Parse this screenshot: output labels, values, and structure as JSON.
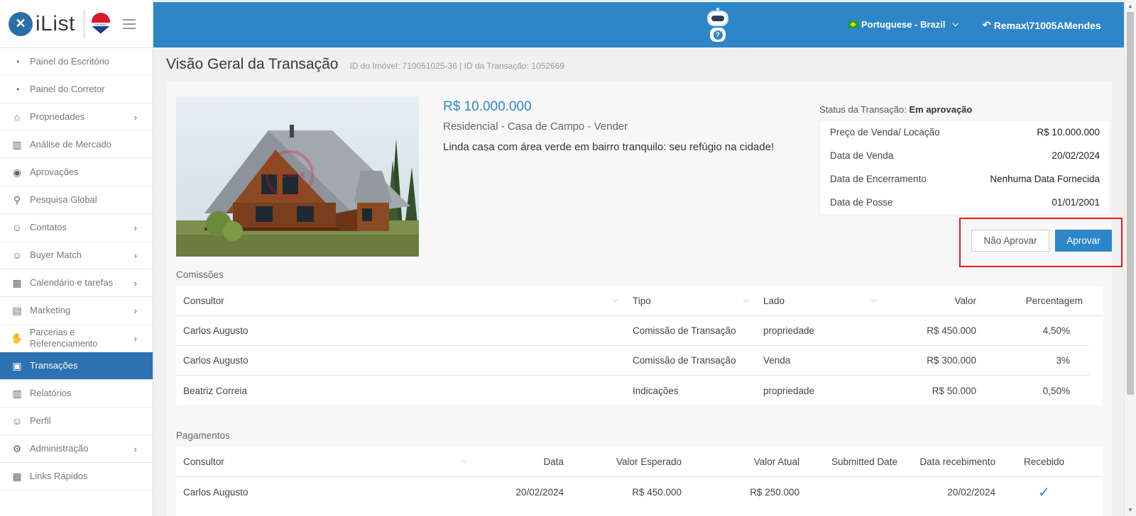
{
  "sidebar": {
    "logo_text": "iList",
    "brand_badge": "RE/MAX",
    "items": [
      {
        "label": "Painel do Escritório",
        "icon": "gauge-icon",
        "glyph": "◔",
        "chevron": false
      },
      {
        "label": "Painel do Corretor",
        "icon": "gauge-icon",
        "glyph": "◔",
        "chevron": false
      },
      {
        "label": "Propriedades",
        "icon": "home-icon",
        "glyph": "⌂",
        "chevron": true
      },
      {
        "label": "Análise de Mercado",
        "icon": "bar-chart-icon",
        "glyph": "▥",
        "chevron": false
      },
      {
        "label": "Aprovações",
        "icon": "eye-icon",
        "glyph": "◉",
        "chevron": false
      },
      {
        "label": "Pesquisa Global",
        "icon": "search-icon",
        "glyph": "⚲",
        "chevron": false
      },
      {
        "label": "Contatos",
        "icon": "contacts-icon",
        "glyph": "☺",
        "chevron": true
      },
      {
        "label": "Buyer Match",
        "icon": "user-icon",
        "glyph": "☺",
        "chevron": true
      },
      {
        "label": "Calendário e tarefas",
        "icon": "calendar-icon",
        "glyph": "▦",
        "chevron": true
      },
      {
        "label": "Marketing",
        "icon": "book-icon",
        "glyph": "▤",
        "chevron": true
      },
      {
        "label": "Parcerias e Referenciamento",
        "icon": "handshake-icon",
        "glyph": "✋",
        "chevron": true
      },
      {
        "label": "Transações",
        "icon": "briefcase-icon",
        "glyph": "▣",
        "chevron": false,
        "active": true
      },
      {
        "label": "Relatórios",
        "icon": "bar-chart-icon",
        "glyph": "▥",
        "chevron": false
      },
      {
        "label": "Perfil",
        "icon": "user-icon",
        "glyph": "☺",
        "chevron": false
      },
      {
        "label": "Administração",
        "icon": "gear-icon",
        "glyph": "⚙",
        "chevron": true
      },
      {
        "label": "Links Rápidos",
        "icon": "building-icon",
        "glyph": "▦",
        "chevron": false
      }
    ]
  },
  "topbar": {
    "language": "Portuguese - Brazil",
    "user": "Remax\\71005AMendes",
    "accent": "#2e86c9"
  },
  "page": {
    "title": "Visão Geral da Transação",
    "subtitle": "ID do Imóvel: 710051025-36 | ID da Transação: 1052669"
  },
  "property": {
    "price": "R$ 10.000.000",
    "type": "Residencial - Casa de Campo - Vender",
    "description": "Linda casa com área verde em bairro tranquilo: seu refúgio na cidade!",
    "watermark": "RE/MAX"
  },
  "status": {
    "label": "Status da Transação:",
    "value": "Em aprovação",
    "rows": [
      {
        "label": "Preço de Venda/ Locação",
        "value": "R$ 10.000.000"
      },
      {
        "label": "Data de Venda",
        "value": "20/02/2024"
      },
      {
        "label": "Data de Encerramento",
        "value": "Nenhuma Data Fornecida"
      },
      {
        "label": "Data de Posse",
        "value": "01/01/2001"
      }
    ]
  },
  "actions": {
    "reject": "Não Aprovar",
    "approve": "Aprovar"
  },
  "commissions": {
    "title": "Comissões",
    "headers": [
      "Consultor",
      "Tipo",
      "Lado",
      "Valor",
      "Percentagem"
    ],
    "rows": [
      [
        "Carlos Augusto",
        "Comissão de Transação",
        "propriedade",
        "R$ 450.000",
        "4,50%"
      ],
      [
        "Carlos Augusto",
        "Comissão de Transação",
        "Venda",
        "R$ 300.000",
        "3%"
      ],
      [
        "Beatriz Correia",
        "Indicações",
        "propriedade",
        "R$ 50.000",
        "0,50%"
      ]
    ]
  },
  "payments": {
    "title": "Pagamentos",
    "headers": [
      "Consultor",
      "Data",
      "Valor Esperado",
      "Valor Atual",
      "Submitted Date",
      "Data recebimento",
      "Recebido"
    ],
    "rows": [
      [
        "Carlos Augusto",
        "20/02/2024",
        "R$ 450.000",
        "R$ 250.000",
        "",
        "20/02/2024",
        "✓"
      ]
    ]
  }
}
